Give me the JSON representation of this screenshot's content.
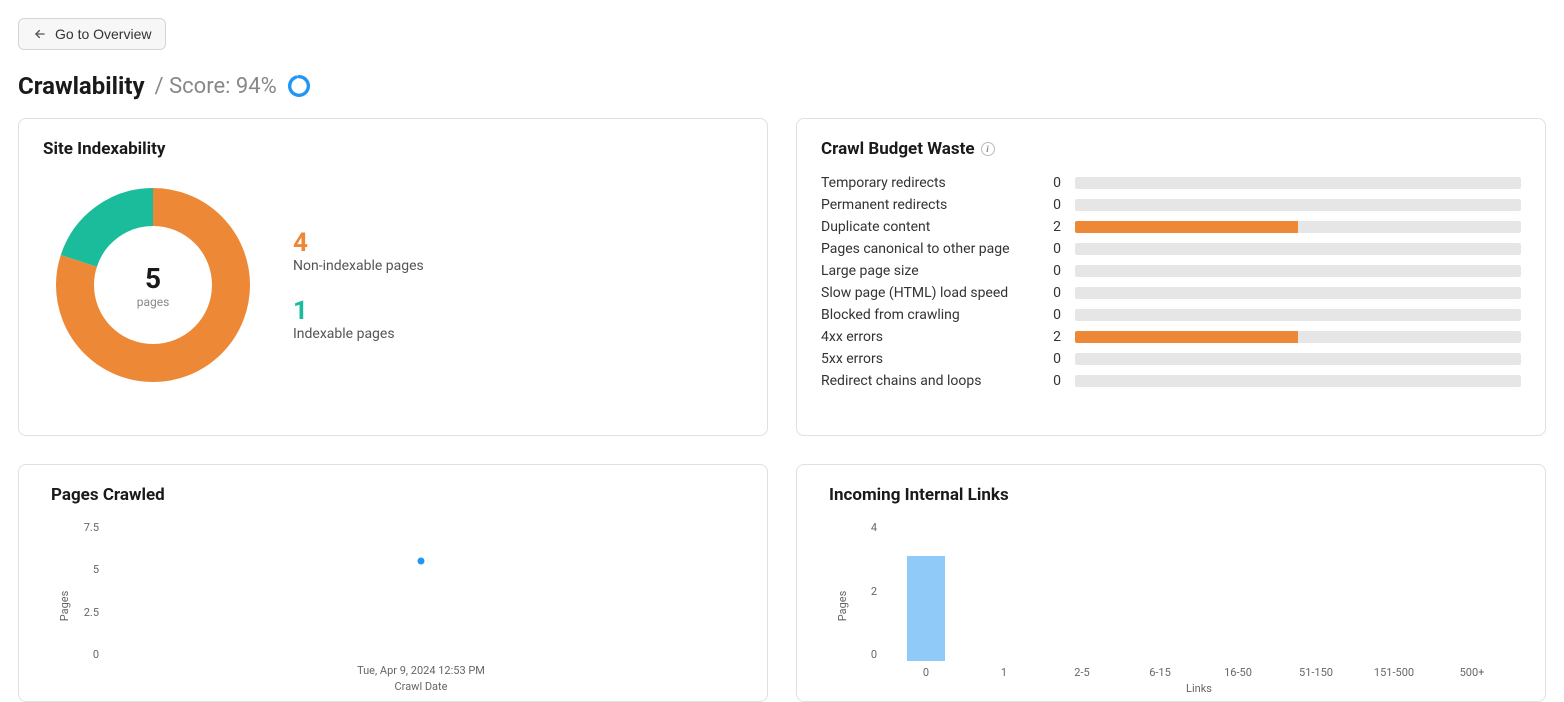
{
  "back_button": "Go to Overview",
  "title": "Crawlability",
  "score_prefix": "/ Score:",
  "score_value": "94%",
  "score_ring_pct": 94,
  "panels": {
    "indexability": {
      "title": "Site Indexability",
      "total_pages": 5,
      "total_label": "pages",
      "non_indexable": 4,
      "non_indexable_label": "Non-indexable pages",
      "indexable": 1,
      "indexable_label": "Indexable pages"
    },
    "crawl_budget_waste": {
      "title": "Crawl Budget Waste",
      "max": 4,
      "rows": [
        {
          "label": "Temporary redirects",
          "value": 0
        },
        {
          "label": "Permanent redirects",
          "value": 0
        },
        {
          "label": "Duplicate content",
          "value": 2
        },
        {
          "label": "Pages canonical to other page",
          "value": 0
        },
        {
          "label": "Large page size",
          "value": 0
        },
        {
          "label": "Slow page (HTML) load speed",
          "value": 0
        },
        {
          "label": "Blocked from crawling",
          "value": 0
        },
        {
          "label": "4xx errors",
          "value": 2
        },
        {
          "label": "5xx errors",
          "value": 0
        },
        {
          "label": "Redirect chains and loops",
          "value": 0
        }
      ]
    },
    "pages_crawled": {
      "title": "Pages Crawled",
      "ylabel": "Pages",
      "xlabel": "Crawl Date"
    },
    "incoming_links": {
      "title": "Incoming Internal Links",
      "ylabel": "Pages",
      "xlabel": "Links"
    }
  },
  "chart_data": [
    {
      "id": "pages_crawled",
      "type": "scatter",
      "x": [
        "Tue, Apr 9, 2024 12:53 PM"
      ],
      "y": [
        5
      ],
      "xlabel": "Crawl Date",
      "ylabel": "Pages",
      "y_ticks": [
        0,
        2.5,
        5,
        7.5
      ],
      "ylim": [
        0,
        7.5
      ]
    },
    {
      "id": "incoming_internal_links",
      "type": "bar",
      "categories": [
        "0",
        "1",
        "2-5",
        "6-15",
        "16-50",
        "51-150",
        "151-500",
        "500+"
      ],
      "values": [
        3,
        0,
        0,
        0,
        0,
        0,
        0,
        0
      ],
      "xlabel": "Links",
      "ylabel": "Pages",
      "y_ticks": [
        0,
        2,
        4
      ],
      "ylim": [
        0,
        4
      ]
    },
    {
      "id": "site_indexability_donut",
      "type": "pie",
      "series": [
        {
          "name": "Non-indexable pages",
          "value": 4,
          "color": "#ed8936"
        },
        {
          "name": "Indexable pages",
          "value": 1,
          "color": "#1abc9c"
        }
      ],
      "total": 5
    }
  ]
}
